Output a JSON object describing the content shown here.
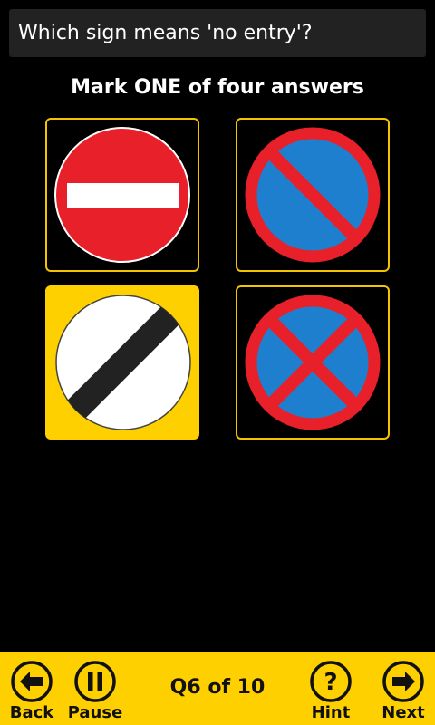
{
  "question": {
    "text": "Which sign means 'no entry'?"
  },
  "instruction": "Mark ONE of four answers",
  "answers": [
    {
      "id": "a",
      "sign": "no-entry-sign-icon",
      "selected": false
    },
    {
      "id": "b",
      "sign": "no-waiting-sign-icon",
      "selected": false
    },
    {
      "id": "c",
      "sign": "national-speed-limit-sign-icon",
      "selected": true
    },
    {
      "id": "d",
      "sign": "no-stopping-clearway-sign-icon",
      "selected": false
    }
  ],
  "toolbar": {
    "back_label": "Back",
    "pause_label": "Pause",
    "progress": "Q6 of 10",
    "hint_label": "Hint",
    "next_label": "Next"
  },
  "colors": {
    "background": "#000000",
    "accent": "#ffd000",
    "sign_red": "#e8202a",
    "sign_blue": "#1f7fcf"
  }
}
